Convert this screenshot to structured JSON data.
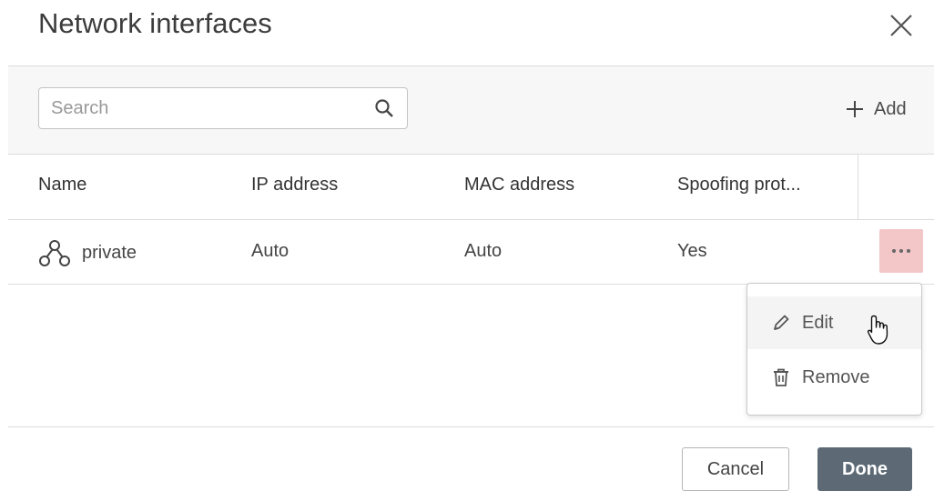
{
  "dialog": {
    "title": "Network interfaces",
    "close_icon": "close-icon"
  },
  "toolbar": {
    "search": {
      "placeholder": "Search",
      "value": "",
      "icon": "search-icon"
    },
    "add_label": "Add",
    "add_icon": "plus-icon"
  },
  "table": {
    "columns": [
      "Name",
      "IP address",
      "MAC address",
      "Spoofing prot..."
    ],
    "rows": [
      {
        "icon": "network-icon",
        "name": "private",
        "ip_address": "Auto",
        "mac_address": "Auto",
        "spoofing_protection": "Yes",
        "actions_icon": "more-icon"
      }
    ]
  },
  "context_menu": {
    "items": [
      {
        "label": "Edit",
        "icon": "pencil-icon"
      },
      {
        "label": "Remove",
        "icon": "trash-icon"
      }
    ]
  },
  "footer": {
    "cancel_label": "Cancel",
    "done_label": "Done"
  },
  "colors": {
    "actions_button_bg": "#f3c6c8",
    "done_button_bg": "#5d6a76",
    "toolbar_bg": "#f7f7f7"
  }
}
